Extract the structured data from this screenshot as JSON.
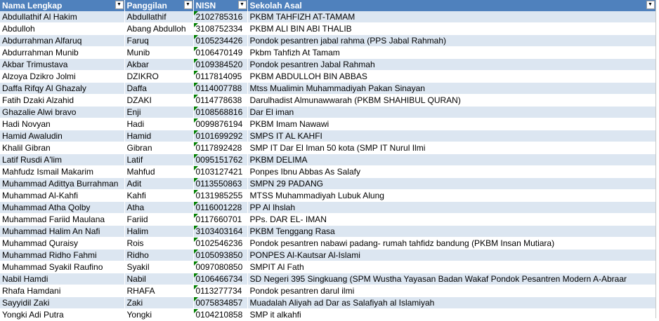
{
  "columns": {
    "nama": "Nama Lengkap",
    "panggilan": "Panggilan",
    "nisn": "NISN",
    "sekolah": "Sekolah Asal"
  },
  "filter_icon": "dropdown-arrow-icon",
  "rows": [
    {
      "nama": "Abdullathif Al Hakim",
      "panggilan": "Abdullathif",
      "nisn": "2102785316",
      "sekolah": "PKBM TAHFIZH AT-TAMAM"
    },
    {
      "nama": "Abdulloh",
      "panggilan": "Abang Abdulloh",
      "nisn": "3108752334",
      "sekolah": "PKBM ALI BIN ABI THALIB"
    },
    {
      "nama": "Abdurrahman Alfaruq",
      "panggilan": "Faruq",
      "nisn": "0105234426",
      "sekolah": "Pondok pesantren jabal rahma (PPS Jabal Rahmah)"
    },
    {
      "nama": "Abdurrahman Munib",
      "panggilan": "Munib",
      "nisn": "0106470149",
      "sekolah": "Pkbm Tahfizh At Tamam"
    },
    {
      "nama": "Akbar Trimustava",
      "panggilan": "Akbar",
      "nisn": "0109384520",
      "sekolah": "Pondok pesantren Jabal Rahmah"
    },
    {
      "nama": "Alzoya Dzikro Jolmi",
      "panggilan": "DZIKRO",
      "nisn": "0117814095",
      "sekolah": "PKBM ABDULLOH BIN ABBAS"
    },
    {
      "nama": "Daffa Rifqy Al Ghazaly",
      "panggilan": "Daffa",
      "nisn": "0114007788",
      "sekolah": "Mtss Mualimin Muhammadiyah Pakan Sinayan"
    },
    {
      "nama": "Fatih Dzaki Alzahid",
      "panggilan": "DZAKI",
      "nisn": "0114778638",
      "sekolah": "Darulhadist Almunawwarah (PKBM SHAHIBUL QURAN)"
    },
    {
      "nama": "Ghazalie Alwi bravo",
      "panggilan": "Enji",
      "nisn": "0108568816",
      "sekolah": "Dar El iman"
    },
    {
      "nama": "Hadi Novyan",
      "panggilan": "Hadi",
      "nisn": "0099876194",
      "sekolah": "PKBM Imam Nawawi"
    },
    {
      "nama": "Hamid Awaludin",
      "panggilan": "Hamid",
      "nisn": "0101699292",
      "sekolah": "SMPS IT AL KAHFI"
    },
    {
      "nama": "Khalil Gibran",
      "panggilan": "Gibran",
      "nisn": "0117892428",
      "sekolah": "SMP IT Dar El Iman 50 kota (SMP IT Nurul Ilmi"
    },
    {
      "nama": "Latif Rusdi A'lim",
      "panggilan": "Latif",
      "nisn": "0095151762",
      "sekolah": "PKBM DELIMA"
    },
    {
      "nama": "Mahfudz Ismail Makarim",
      "panggilan": "Mahfud",
      "nisn": "0103127421",
      "sekolah": "Ponpes Ibnu Abbas As Salafy"
    },
    {
      "nama": "Muhammad Adittya Burrahman",
      "panggilan": "Adit",
      "nisn": "0113550863",
      "sekolah": "SMPN 29 PADANG"
    },
    {
      "nama": "Muhammad Al-Kahfi",
      "panggilan": "Kahfi",
      "nisn": "0131985255",
      "sekolah": "MTSS Muhammadiyah Lubuk Alung"
    },
    {
      "nama": "Muhammad Atha Qolby",
      "panggilan": "Atha",
      "nisn": "0116001228",
      "sekolah": "PP Al Ihslah"
    },
    {
      "nama": "Muhammad Fariid Maulana",
      "panggilan": "Fariid",
      "nisn": "0117660701",
      "sekolah": "PPs. DAR EL- IMAN"
    },
    {
      "nama": "Muhammad Halim An Nafi",
      "panggilan": "Halim",
      "nisn": "3103403164",
      "sekolah": "PKBM Tenggang Rasa"
    },
    {
      "nama": "Muhammad Quraisy",
      "panggilan": "Rois",
      "nisn": "0102546236",
      "sekolah": "Pondok pesantren nabawi padang- rumah tahfidz bandung (PKBM Insan Mutiara)"
    },
    {
      "nama": "Muhammad Ridho Fahmi",
      "panggilan": "Ridho",
      "nisn": "0105093850",
      "sekolah": "PONPES Al-Kautsar Al-Islami"
    },
    {
      "nama": "Muhammad Syakil Raufino",
      "panggilan": "Syakil",
      "nisn": "0097080850",
      "sekolah": "SMPIT Al Fath"
    },
    {
      "nama": "Nabil Hamdi",
      "panggilan": "Nabil",
      "nisn": "0106466734",
      "sekolah": "SD Negeri 395 Singkuang (SPM Wustha Yayasan Badan Wakaf Pondok Pesantren Modern A-Abraar"
    },
    {
      "nama": "Rhafa Hamdani",
      "panggilan": "RHAFA",
      "nisn": "0113277734",
      "sekolah": "Pondok pesantren darul ilmi"
    },
    {
      "nama": "Sayyidil Zaki",
      "panggilan": "Zaki",
      "nisn": "0075834857",
      "sekolah": "Muadalah Aliyah ad Dar as Salafiyah al Islamiyah"
    },
    {
      "nama": "Yongki Adi Putra",
      "panggilan": "Yongki",
      "nisn": "0104210858",
      "sekolah": "SMP it alkahfi"
    }
  ]
}
